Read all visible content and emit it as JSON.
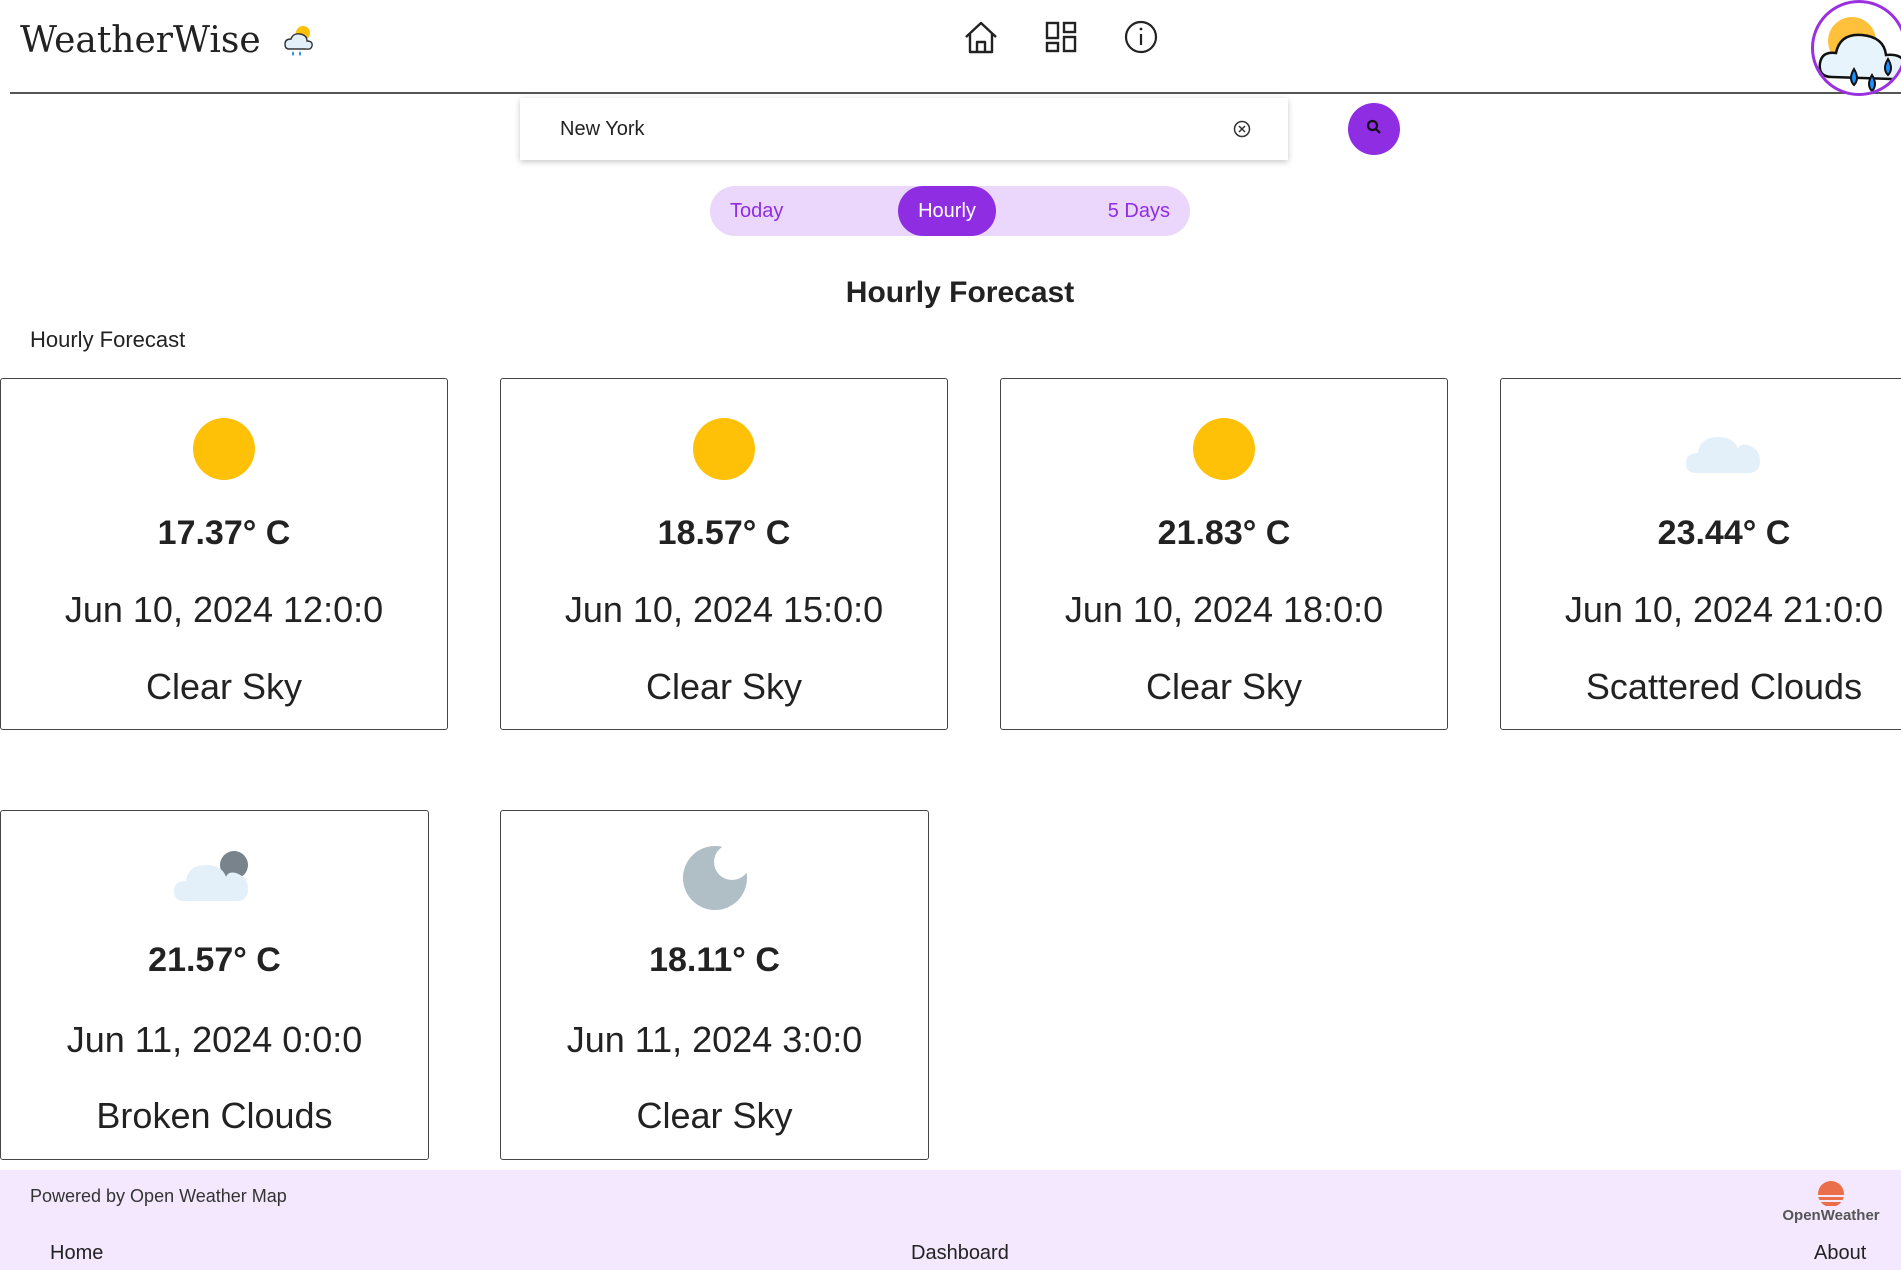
{
  "header": {
    "app_title": "WeatherWise",
    "nav": [
      {
        "name": "home",
        "icon": "home-icon"
      },
      {
        "name": "dashboard",
        "icon": "dashboard-icon"
      },
      {
        "name": "about",
        "icon": "info-icon"
      }
    ]
  },
  "search": {
    "value": "New York",
    "placeholder": ""
  },
  "tabs": [
    {
      "label": "Today",
      "active": false
    },
    {
      "label": "Hourly",
      "active": true
    },
    {
      "label": "5 Days",
      "active": false
    }
  ],
  "main": {
    "title": "Hourly Forecast",
    "subtitle": "Hourly Forecast",
    "cards": [
      {
        "temp": "17.37° C",
        "time": "Jun 10, 2024 12:0:0",
        "desc": "Clear Sky",
        "icon": "sun-icon"
      },
      {
        "temp": "18.57° C",
        "time": "Jun 10, 2024 15:0:0",
        "desc": "Clear Sky",
        "icon": "sun-icon"
      },
      {
        "temp": "21.83° C",
        "time": "Jun 10, 2024 18:0:0",
        "desc": "Clear Sky",
        "icon": "sun-icon"
      },
      {
        "temp": "23.44° C",
        "time": "Jun 10, 2024 21:0:0",
        "desc": "Scattered Clouds",
        "icon": "cloud-icon"
      },
      {
        "temp": "21.57° C",
        "time": "Jun 11, 2024 0:0:0",
        "desc": "Broken Clouds",
        "icon": "broken-clouds-icon"
      },
      {
        "temp": "18.11° C",
        "time": "Jun 11, 2024 3:0:0",
        "desc": "Clear Sky",
        "icon": "moon-icon"
      }
    ]
  },
  "footer": {
    "powered_by": "Powered by Open Weather Map",
    "logo_text": "OpenWeather",
    "links": [
      "Home",
      "Dashboard",
      "About"
    ]
  },
  "colors": {
    "accent": "#8e2de2",
    "tab_bg": "#ead7fb",
    "footer_bg": "#f3e8fd",
    "sun": "#ffc107",
    "cloud": "#e3f0fa",
    "moon": "#b0bec5"
  }
}
